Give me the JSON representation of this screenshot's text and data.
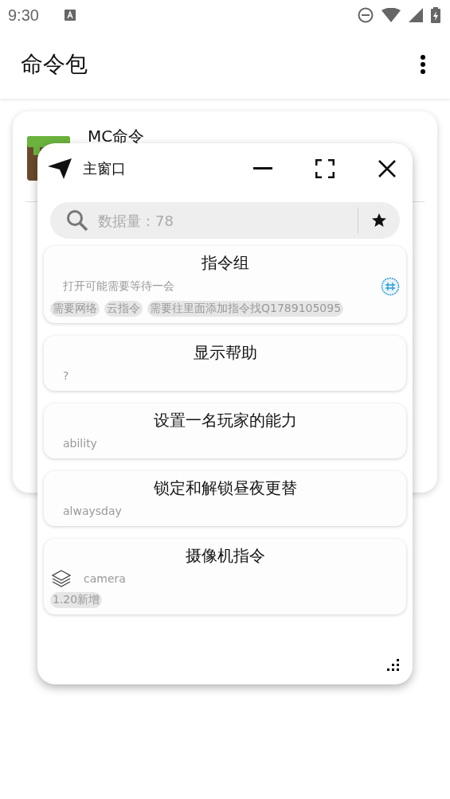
{
  "status_bar": {
    "time": "9:30"
  },
  "app_bar": {
    "title": "命令包"
  },
  "background_card": {
    "title": "MC命令"
  },
  "floating_window": {
    "title": "主窗口",
    "search": {
      "placeholder": "数据量：78"
    },
    "commands": [
      {
        "kind": "stamp",
        "title": "指令组",
        "subtitle": "打开可能需要等待一会",
        "tags": [
          "需要网络",
          "云指令",
          "需要往里面添加指令找Q1789105095"
        ]
      },
      {
        "kind": "plain",
        "title": "显示帮助",
        "subtitle": "?"
      },
      {
        "kind": "plain",
        "title": "设置一名玩家的能力",
        "subtitle": "ability"
      },
      {
        "kind": "plain",
        "title": "锁定和解锁昼夜更替",
        "subtitle": "alwaysday"
      },
      {
        "kind": "layers",
        "title": "摄像机指令",
        "subtitle": "camera",
        "tags": [
          "1.20新增"
        ]
      }
    ]
  }
}
